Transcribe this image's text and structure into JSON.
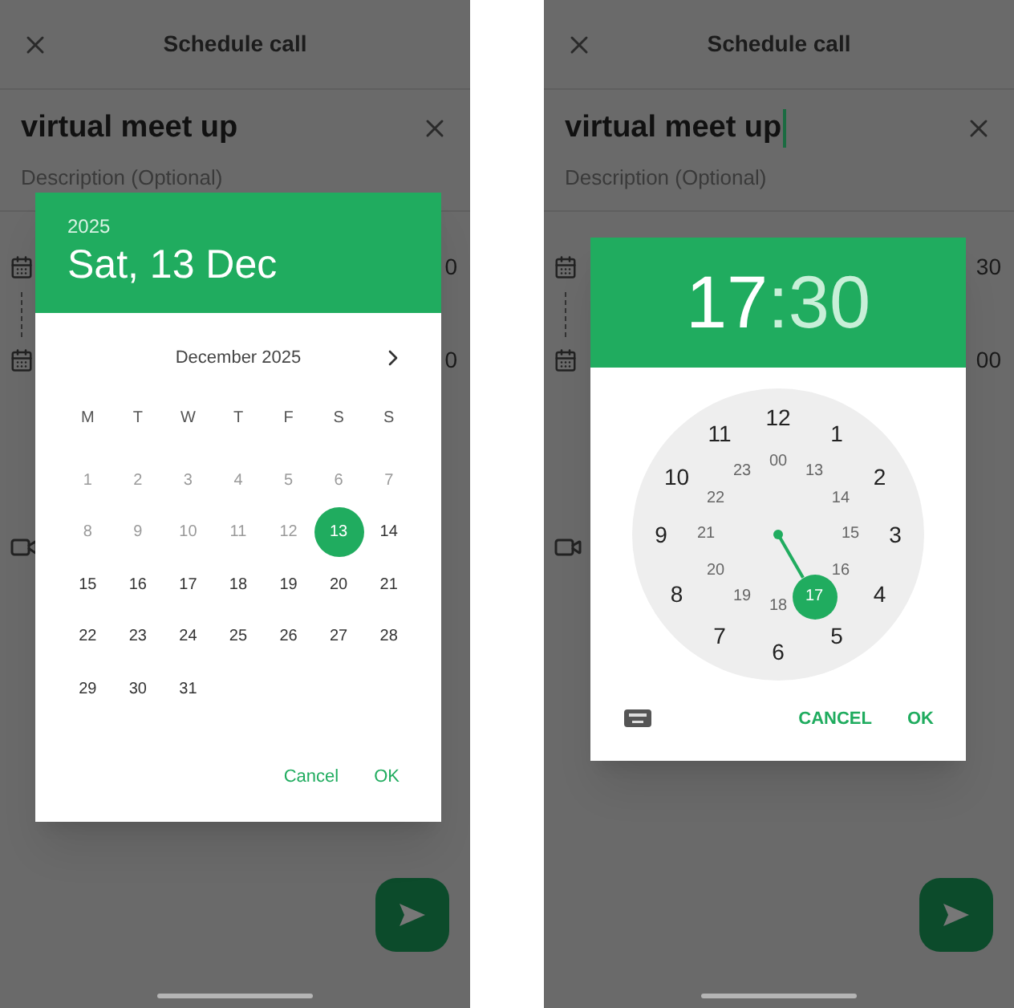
{
  "screens": [
    {
      "kind": "date",
      "header": {
        "title": "Schedule call"
      },
      "event_title": {
        "value": "virtual meet up",
        "focused": false
      },
      "description": {
        "placeholder": "Description (Optional)"
      },
      "rows": [
        {
          "kind": "calendar",
          "text": "0"
        },
        {
          "kind": "calendar",
          "text": "0"
        },
        {
          "kind": "video"
        }
      ],
      "date_picker": {
        "year": "2025",
        "date": "Sat, 13 Dec",
        "month": "December 2025",
        "weekdays": [
          "M",
          "T",
          "W",
          "T",
          "F",
          "S",
          "S"
        ],
        "days": [
          {
            "label": "1",
            "disabled": true,
            "selected": false
          },
          {
            "label": "2",
            "disabled": true,
            "selected": false
          },
          {
            "label": "3",
            "disabled": true,
            "selected": false
          },
          {
            "label": "4",
            "disabled": true,
            "selected": false
          },
          {
            "label": "5",
            "disabled": true,
            "selected": false
          },
          {
            "label": "6",
            "disabled": true,
            "selected": false
          },
          {
            "label": "7",
            "disabled": true,
            "selected": false
          },
          {
            "label": "8",
            "disabled": true,
            "selected": false
          },
          {
            "label": "9",
            "disabled": true,
            "selected": false
          },
          {
            "label": "10",
            "disabled": true,
            "selected": false
          },
          {
            "label": "11",
            "disabled": true,
            "selected": false
          },
          {
            "label": "12",
            "disabled": true,
            "selected": false
          },
          {
            "label": "13",
            "disabled": false,
            "selected": true
          },
          {
            "label": "14",
            "disabled": false,
            "selected": false
          },
          {
            "label": "15",
            "disabled": false,
            "selected": false
          },
          {
            "label": "16",
            "disabled": false,
            "selected": false
          },
          {
            "label": "17",
            "disabled": false,
            "selected": false
          },
          {
            "label": "18",
            "disabled": false,
            "selected": false
          },
          {
            "label": "19",
            "disabled": false,
            "selected": false
          },
          {
            "label": "20",
            "disabled": false,
            "selected": false
          },
          {
            "label": "21",
            "disabled": false,
            "selected": false
          },
          {
            "label": "22",
            "disabled": false,
            "selected": false
          },
          {
            "label": "23",
            "disabled": false,
            "selected": false
          },
          {
            "label": "24",
            "disabled": false,
            "selected": false
          },
          {
            "label": "25",
            "disabled": false,
            "selected": false
          },
          {
            "label": "26",
            "disabled": false,
            "selected": false
          },
          {
            "label": "27",
            "disabled": false,
            "selected": false
          },
          {
            "label": "28",
            "disabled": false,
            "selected": false
          },
          {
            "label": "29",
            "disabled": false,
            "selected": false
          },
          {
            "label": "30",
            "disabled": false,
            "selected": false
          },
          {
            "label": "31",
            "disabled": false,
            "selected": false
          }
        ],
        "buttons": [
          "Cancel",
          "OK"
        ]
      }
    },
    {
      "kind": "time",
      "header": {
        "title": "Schedule call"
      },
      "event_title": {
        "value": "virtual meet up",
        "focused": true
      },
      "description": {
        "placeholder": "Description (Optional)"
      },
      "rows": [
        {
          "kind": "calendar",
          "text": "30"
        },
        {
          "kind": "calendar",
          "text": "00"
        },
        {
          "kind": "video"
        }
      ],
      "time_picker": {
        "hour": "17",
        "separator": ":",
        "minute": "30",
        "outer": [
          {
            "label": "12",
            "selected": false
          },
          {
            "label": "1",
            "selected": false
          },
          {
            "label": "2",
            "selected": false
          },
          {
            "label": "3",
            "selected": false
          },
          {
            "label": "4",
            "selected": false
          },
          {
            "label": "5",
            "selected": false
          },
          {
            "label": "6",
            "selected": false
          },
          {
            "label": "7",
            "selected": false
          },
          {
            "label": "8",
            "selected": false
          },
          {
            "label": "9",
            "selected": false
          },
          {
            "label": "10",
            "selected": false
          },
          {
            "label": "11",
            "selected": false
          }
        ],
        "inner": [
          {
            "label": "00",
            "selected": false
          },
          {
            "label": "13",
            "selected": false
          },
          {
            "label": "14",
            "selected": false
          },
          {
            "label": "15",
            "selected": false
          },
          {
            "label": "16",
            "selected": false
          },
          {
            "label": "17",
            "selected": true
          },
          {
            "label": "18",
            "selected": false
          },
          {
            "label": "19",
            "selected": false
          },
          {
            "label": "20",
            "selected": false
          },
          {
            "label": "21",
            "selected": false
          },
          {
            "label": "22",
            "selected": false
          },
          {
            "label": "23",
            "selected": false
          }
        ],
        "buttons": [
          "CANCEL",
          "OK"
        ]
      }
    }
  ]
}
